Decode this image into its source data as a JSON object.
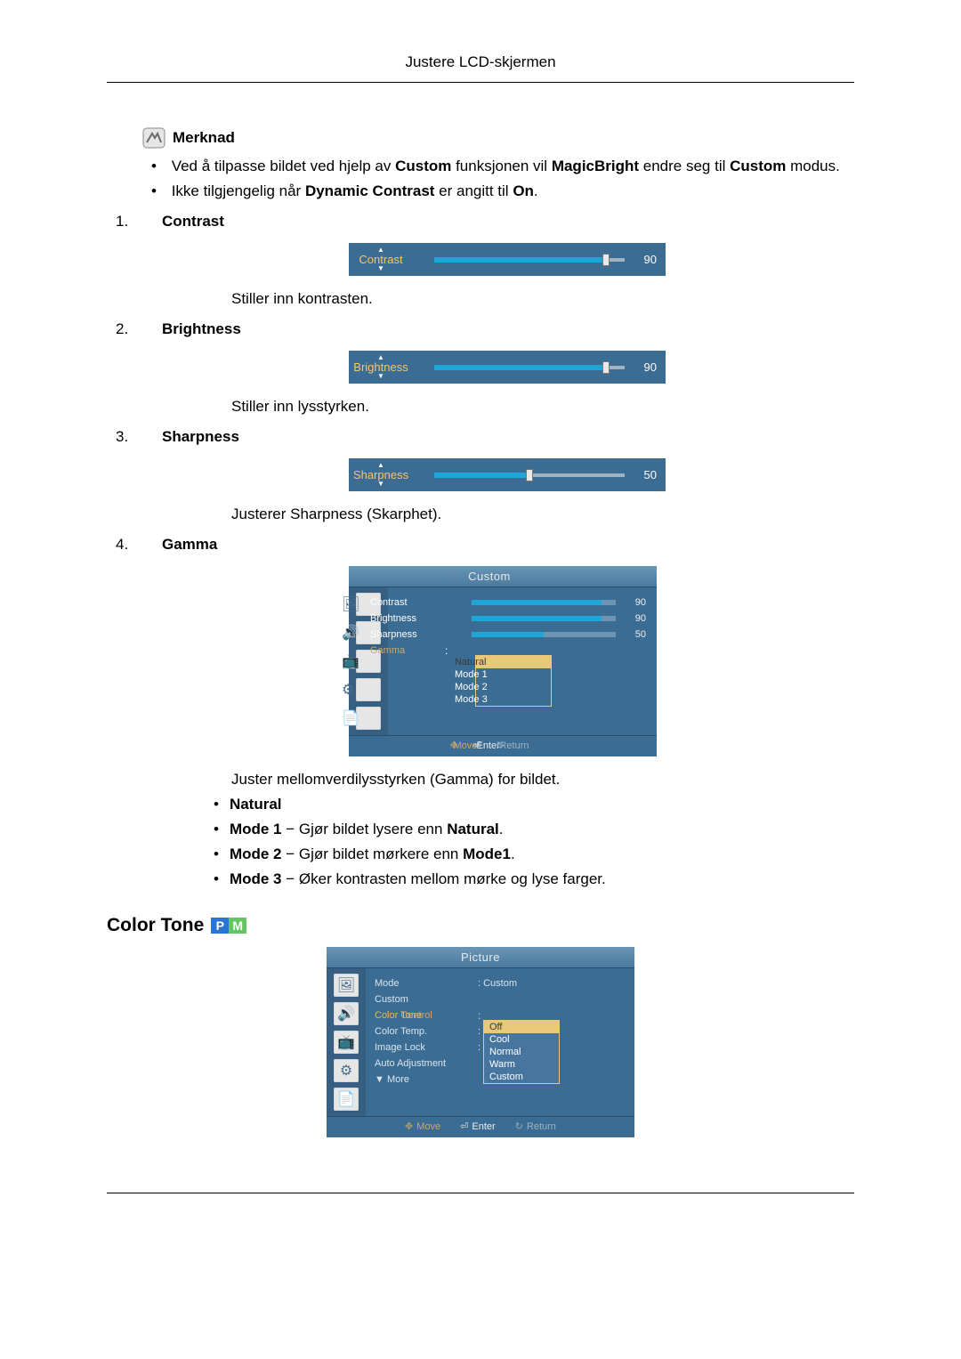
{
  "page_header": "Justere LCD-skjermen",
  "note_label": "Merknad",
  "note_items": {
    "a_pre": "Ved å tilpasse bildet ved hjelp av ",
    "a_b1": "Custom",
    "a_mid": " funksjonen vil ",
    "a_b2": "MagicBright",
    "a_mid2": " endre seg til ",
    "a_b3": "Custom",
    "a_post": " modus.",
    "b_pre": "Ikke tilgjengelig når ",
    "b_b1": "Dynamic Contrast",
    "b_mid": " er angitt til ",
    "b_b2": "On",
    "b_post": "."
  },
  "items": {
    "1": {
      "num": "1.",
      "title": "Contrast",
      "slider_label": "Contrast",
      "value": 90,
      "desc": "Stiller inn kontrasten."
    },
    "2": {
      "num": "2.",
      "title": "Brightness",
      "slider_label": "Brightness",
      "value": 90,
      "desc": "Stiller inn lysstyrken."
    },
    "3": {
      "num": "3.",
      "title": "Sharpness",
      "slider_label": "Sharpness",
      "value": 50,
      "desc": "Justerer Sharpness (Skarphet)."
    },
    "4": {
      "num": "4.",
      "title": "Gamma",
      "desc_after": "Juster mellomverdilysstyrken (Gamma) for bildet."
    }
  },
  "custom_osd": {
    "title": "Custom",
    "rows": {
      "contrast": {
        "label": "Contrast",
        "value": 90
      },
      "brightness": {
        "label": "Brightness",
        "value": 90
      },
      "sharpness": {
        "label": "Sharpness",
        "value": 50
      },
      "gamma": {
        "label": "Gamma",
        "selected": "Natural",
        "options": [
          "Natural",
          "Mode 1",
          "Mode 2",
          "Mode 3"
        ]
      }
    },
    "footer": {
      "move": "Move",
      "enter": "Enter",
      "ret": "Return"
    }
  },
  "gamma_modes": {
    "natural": "Natural",
    "m1_b": "Mode 1",
    "m1_txt": " − Gjør bildet lysere enn ",
    "m1_b2": "Natural",
    "m1_post": ".",
    "m2_b": "Mode 2",
    "m2_txt": " − Gjør bildet mørkere enn ",
    "m2_b2": "Mode1",
    "m2_post": ".",
    "m3_b": "Mode 3",
    "m3_txt": " − Øker kontrasten mellom mørke og lyse farger."
  },
  "color_tone": {
    "heading": "Color Tone",
    "osd": {
      "title": "Picture",
      "rows": {
        "mode": {
          "label": "Mode",
          "value": ": Custom"
        },
        "custom": {
          "label": "Custom"
        },
        "color_tone": {
          "label": "Color Tone",
          "selected": "Off",
          "options": [
            "Off",
            "Cool",
            "Normal",
            "Warm",
            "Custom"
          ]
        },
        "color_control": {
          "label": "Color Control"
        },
        "color_temp": {
          "label": "Color Temp.",
          "value": ":"
        },
        "image_lock": {
          "label": "Image Lock",
          "value": ":"
        },
        "auto_adjust": {
          "label": "Auto Adjustment"
        },
        "more": {
          "label": "▼ More"
        }
      },
      "footer": {
        "move": "Move",
        "enter": "Enter",
        "ret": "Return"
      }
    }
  }
}
